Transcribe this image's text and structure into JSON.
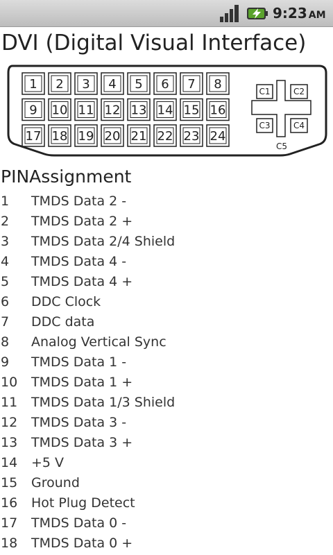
{
  "status": {
    "time": "9:23",
    "ampm": "AM"
  },
  "title": "DVI (Digital Visual Interface)",
  "connector": {
    "pins": [
      "1",
      "2",
      "3",
      "4",
      "5",
      "6",
      "7",
      "8",
      "9",
      "10",
      "11",
      "12",
      "13",
      "14",
      "15",
      "16",
      "17",
      "18",
      "19",
      "20",
      "21",
      "22",
      "23",
      "24"
    ],
    "c_labels": [
      "C1",
      "C2",
      "C3",
      "C4",
      "C5"
    ]
  },
  "header": {
    "pin": "PIN",
    "assignment": "Assignment"
  },
  "assignments": [
    {
      "pin": "1",
      "desc": "TMDS Data 2 -"
    },
    {
      "pin": "2",
      "desc": "TMDS Data 2 +"
    },
    {
      "pin": "3",
      "desc": "TMDS Data 2/4 Shield"
    },
    {
      "pin": "4",
      "desc": "TMDS Data 4 -"
    },
    {
      "pin": "5",
      "desc": "TMDS Data 4 +"
    },
    {
      "pin": "6",
      "desc": "DDC Clock"
    },
    {
      "pin": "7",
      "desc": "DDC data"
    },
    {
      "pin": "8",
      "desc": "Analog Vertical Sync"
    },
    {
      "pin": "9",
      "desc": "TMDS Data 1 -"
    },
    {
      "pin": "10",
      "desc": "TMDS Data 1 +"
    },
    {
      "pin": "11",
      "desc": "TMDS Data 1/3 Shield"
    },
    {
      "pin": "12",
      "desc": "TMDS Data 3 -"
    },
    {
      "pin": "13",
      "desc": "TMDS Data 3 +"
    },
    {
      "pin": "14",
      "desc": "+5 V"
    },
    {
      "pin": "15",
      "desc": "Ground"
    },
    {
      "pin": "16",
      "desc": "Hot Plug Detect"
    },
    {
      "pin": "17",
      "desc": "TMDS Data 0 -"
    },
    {
      "pin": "18",
      "desc": "TMDS Data 0 +"
    }
  ]
}
